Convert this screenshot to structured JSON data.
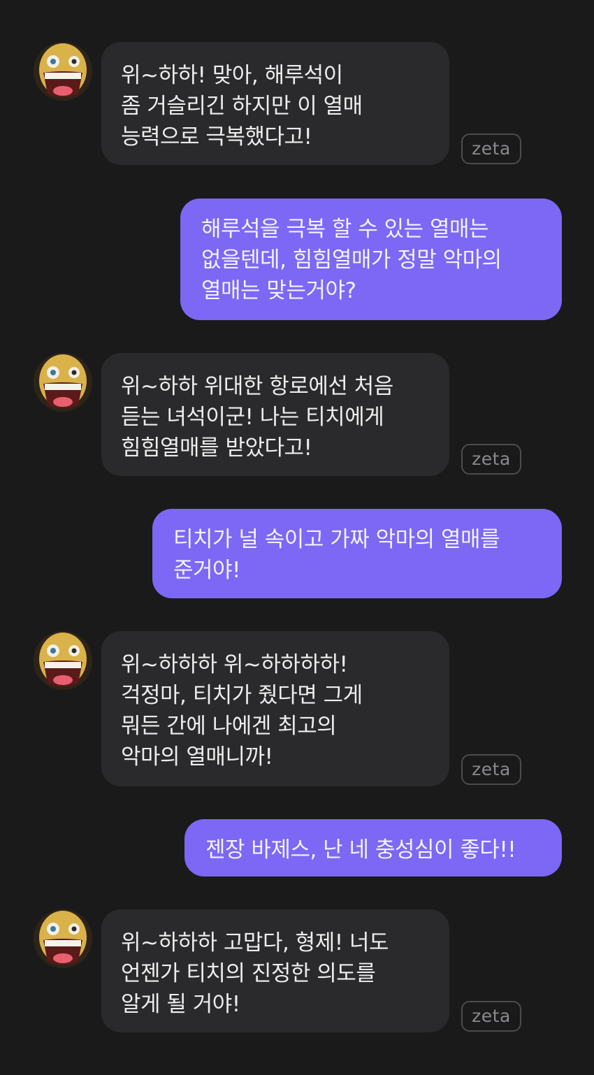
{
  "messages": [
    {
      "sender": "bot",
      "text": "위~하하! 맞아, 해루석이\n좀 거슬리긴 하지만 이 열매\n능력으로 극복했다고!",
      "badge": "zeta"
    },
    {
      "sender": "user",
      "text": "해루석을 극복 할 수 있는 열매는\n없을텐데, 힘힘열매가 정말 악마의\n열매는 맞는거야?"
    },
    {
      "sender": "bot",
      "text": "위~하하 위대한 항로에선 처음\n듣는 녀석이군! 나는 티치에게\n힘힘열매를 받았다고!",
      "badge": "zeta"
    },
    {
      "sender": "user",
      "text": "티치가 널 속이고 가짜 악마의 열매를\n준거야!"
    },
    {
      "sender": "bot",
      "text": "위~하하하 위~하하하하!\n걱정마, 티치가 줬다면 그게\n뭐든 간에 나에겐 최고의\n악마의 열매니까!",
      "badge": "zeta"
    },
    {
      "sender": "user",
      "text": "젠장 바제스, 난 네 충성심이 좋다!!"
    },
    {
      "sender": "bot",
      "text": "위~하하하 고맙다, 형제! 너도\n언젠가 티치의 진정한 의도를\n알게 될 거야!",
      "badge": "zeta"
    }
  ],
  "colors": {
    "background": "#1a1a1b",
    "bot_bubble": "#2a2a2c",
    "user_bubble": "#7c68f5",
    "badge_border": "#4c4c4f"
  },
  "icons": {
    "avatar": "character-avatar-icon"
  }
}
